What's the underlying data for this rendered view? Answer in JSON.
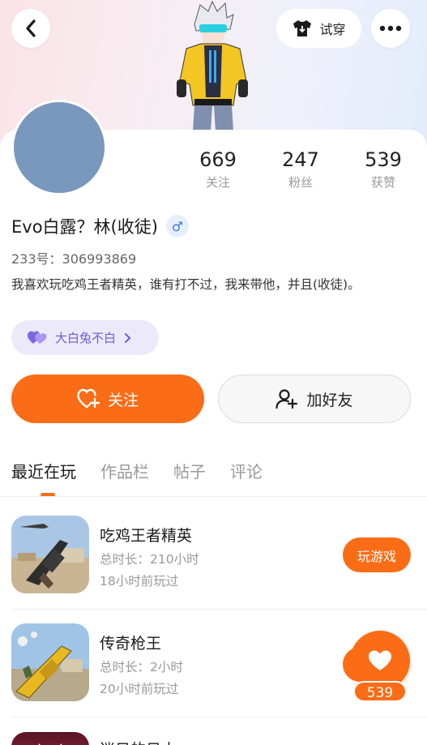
{
  "header": {
    "try_on_label": "试穿"
  },
  "profile": {
    "name": "Evo白露？林(收徒)",
    "gender_symbol": "♂",
    "uid": "233号：306993869",
    "bio": "我喜欢玩吃鸡王者精英，谁有打不过，我来带他，并且(收徒)。",
    "guild_label": "大白兔不白",
    "avatar_color": "#7a97bd"
  },
  "stats": [
    {
      "value": "669",
      "label": "关注"
    },
    {
      "value": "247",
      "label": "粉丝"
    },
    {
      "value": "539",
      "label": "获赞"
    }
  ],
  "actions": {
    "follow_label": "关注",
    "add_friend_label": "加好友"
  },
  "tabs": [
    {
      "label": "最近在玩",
      "active": true
    },
    {
      "label": "作品栏",
      "active": false
    },
    {
      "label": "帖子",
      "active": false
    },
    {
      "label": "评论",
      "active": false
    }
  ],
  "games": [
    {
      "name": "吃鸡王者精英",
      "duration": "总时长：210小时",
      "last_played": "18小时前玩过",
      "button": "玩游戏"
    },
    {
      "name": "传奇枪王",
      "duration": "总时长：2小时",
      "last_played": "20小时前玩过",
      "button": ""
    },
    {
      "name": "迷日的日士",
      "duration": "",
      "last_played": "",
      "button": ""
    }
  ],
  "floating_like": {
    "count": "539"
  },
  "colors": {
    "accent": "#fb6c17",
    "guild_purple": "#6c5cd4"
  }
}
